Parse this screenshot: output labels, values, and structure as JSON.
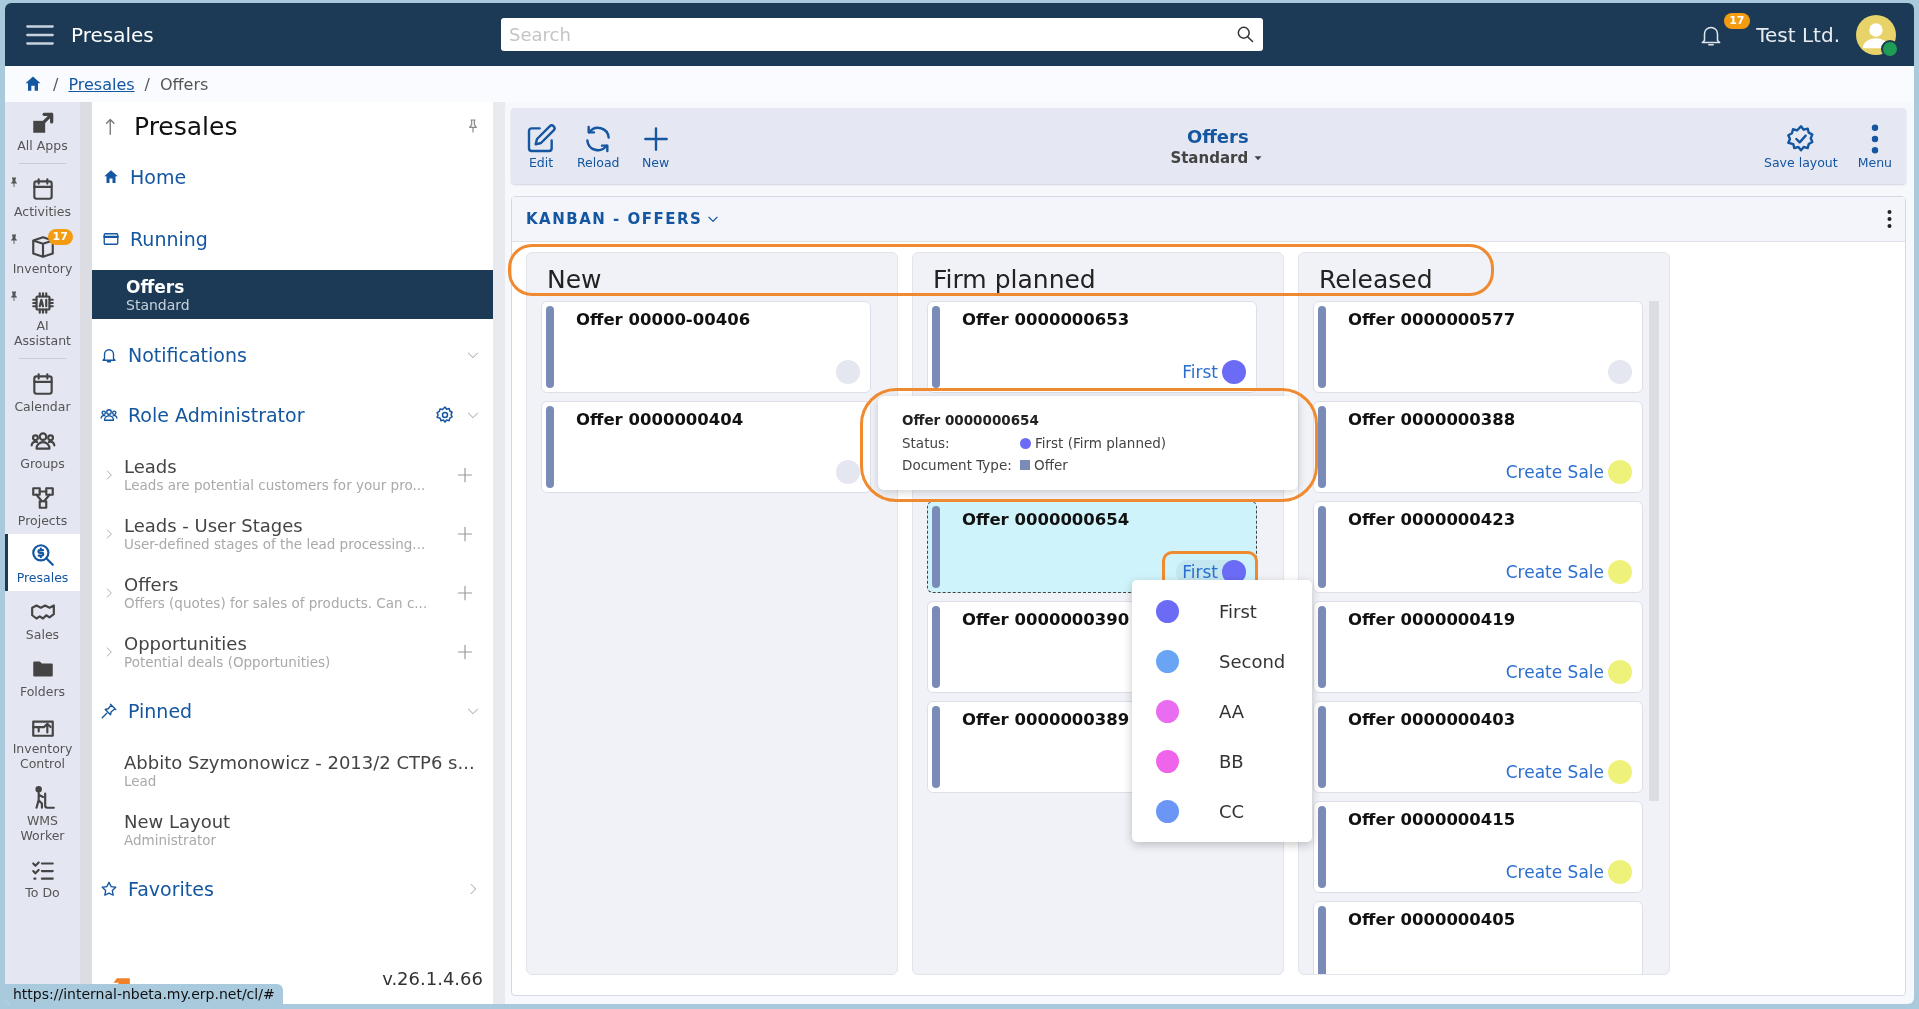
{
  "app_bar": {
    "title": "Presales",
    "search": {
      "placeholder": "Search"
    },
    "notifications": {
      "count": "17"
    },
    "company": "Test Ltd.",
    "user": {
      "online": true
    }
  },
  "breadcrumb": {
    "separator": "/",
    "items": [
      {
        "label": "Presales",
        "link": true
      },
      {
        "label": "Offers",
        "link": false
      }
    ]
  },
  "rail_groups": [
    {
      "items": [
        {
          "label": "All Apps",
          "pinned": false,
          "selected": false
        }
      ]
    },
    {
      "items": [
        {
          "label": "Activities",
          "pinned": true,
          "selected": false
        },
        {
          "label": "Inventory",
          "pinned": true,
          "selected": false,
          "badge": "17"
        },
        {
          "label": "AI Assistant",
          "pinned": true,
          "selected": false
        }
      ]
    },
    {
      "items": [
        {
          "label": "Calendar",
          "pinned": false,
          "selected": false
        },
        {
          "label": "Groups",
          "pinned": false,
          "selected": false
        },
        {
          "label": "Projects",
          "pinned": false,
          "selected": false
        },
        {
          "label": "Presales",
          "pinned": false,
          "selected": true
        },
        {
          "label": "Sales",
          "pinned": false,
          "selected": false
        },
        {
          "label": "Folders",
          "pinned": false,
          "selected": false
        },
        {
          "label": "Inventory Control",
          "pinned": false,
          "selected": false
        },
        {
          "label": "WMS Worker",
          "pinned": false,
          "selected": false
        },
        {
          "label": "To Do",
          "pinned": false,
          "selected": false
        }
      ]
    }
  ],
  "nav": {
    "title": "Presales",
    "items": [
      {
        "kind": "link",
        "label": "Home",
        "selected": false
      },
      {
        "kind": "link",
        "label": "Running",
        "selected": false
      },
      {
        "kind": "link",
        "label": "Offers",
        "sublabel": "Standard",
        "selected": true
      },
      {
        "kind": "section",
        "label": "Notifications",
        "expanded": true
      },
      {
        "kind": "section",
        "label": "Role Administrator",
        "expanded": true,
        "settings": true,
        "children": [
          {
            "kind": "entity",
            "label": "Leads",
            "description": "Leads are potential customers for your pro..."
          },
          {
            "kind": "entity",
            "label": "Leads - User Stages",
            "description": "User-defined stages of the lead processing..."
          },
          {
            "kind": "entity",
            "label": "Offers",
            "description": "Offers (quotes) for sales of products. Can c..."
          },
          {
            "kind": "entity",
            "label": "Opportunities",
            "description": "Potential deals (Opportunities)"
          }
        ]
      },
      {
        "kind": "section",
        "label": "Pinned",
        "expanded": true,
        "children": [
          {
            "kind": "pinned",
            "label": "Abbito Szymonowicz - 2013/2 CTP6 s...",
            "description": "Lead"
          },
          {
            "kind": "pinned",
            "label": "New Layout",
            "description": "Administrator"
          }
        ]
      },
      {
        "kind": "section",
        "label": "Favorites",
        "expanded": false
      }
    ]
  },
  "version": "v.26.1.4.66",
  "status_url": "https://internal-nbeta.my.erp.net/cl/#",
  "toolbar": {
    "actions": [
      {
        "label": "Edit"
      },
      {
        "label": "Reload"
      },
      {
        "label": "New"
      }
    ],
    "title": "Offers",
    "view": "Standard",
    "right_actions": [
      {
        "label": "Save layout"
      },
      {
        "label": "Menu"
      }
    ]
  },
  "kanban": {
    "title": "KANBAN - OFFERS",
    "headers_highlighted": true,
    "columns": [
      {
        "title": "New",
        "cards": [
          {
            "title": "Offer 00000-00406",
            "selected": false,
            "status": {
              "color": "#e4e6f0"
            }
          },
          {
            "title": "Offer 0000000404",
            "selected": false,
            "status": {
              "color": "#e4e6f0"
            }
          }
        ]
      },
      {
        "title": "Firm planned",
        "cards": [
          {
            "title": "Offer 0000000653",
            "selected": false,
            "status": {
              "label": "First",
              "color": "#6b6bf5"
            }
          },
          {
            "kind": "covered"
          },
          {
            "title": "Offer 0000000654",
            "selected": true,
            "status": {
              "label": "First",
              "color": "#6b6bf5",
              "highlighted": true
            }
          },
          {
            "title": "Offer 0000000390",
            "selected": false
          },
          {
            "title": "Offer 0000000389",
            "selected": false
          }
        ]
      },
      {
        "title": "Released",
        "cards": [
          {
            "title": "Offer 0000000577",
            "selected": false,
            "status": {
              "color": "#e4e6f0"
            }
          },
          {
            "title": "Offer 0000000388",
            "selected": false,
            "status": {
              "label": "Create Sale",
              "color": "#eef27a"
            }
          },
          {
            "title": "Offer 0000000423",
            "selected": false,
            "status": {
              "label": "Create Sale",
              "color": "#eef27a"
            }
          },
          {
            "title": "Offer 0000000419",
            "selected": false,
            "status": {
              "label": "Create Sale",
              "color": "#eef27a"
            }
          },
          {
            "title": "Offer 0000000403",
            "selected": false,
            "status": {
              "label": "Create Sale",
              "color": "#eef27a"
            }
          },
          {
            "title": "Offer 0000000415",
            "selected": false,
            "status": {
              "label": "Create Sale",
              "color": "#eef27a"
            }
          },
          {
            "title": "Offer 0000000405",
            "selected": false
          }
        ]
      }
    ],
    "tooltip": {
      "title": "Offer 0000000654",
      "highlighted": true,
      "rows": [
        {
          "label": "Status:",
          "kind": "dot",
          "color": "#6b6bf5",
          "value": "First (Firm planned)"
        },
        {
          "label": "Document Type:",
          "kind": "square",
          "color": "#7b8bb8",
          "value": "Offer"
        }
      ]
    },
    "status_menu": {
      "options": [
        {
          "label": "First",
          "color": "#6b6bf5"
        },
        {
          "label": "Second",
          "color": "#6aa5f5"
        },
        {
          "label": "AA",
          "color": "#ea6cf0"
        },
        {
          "label": "BB",
          "color": "#ee64ea"
        },
        {
          "label": "CC",
          "color": "#6b96f5"
        }
      ]
    }
  }
}
